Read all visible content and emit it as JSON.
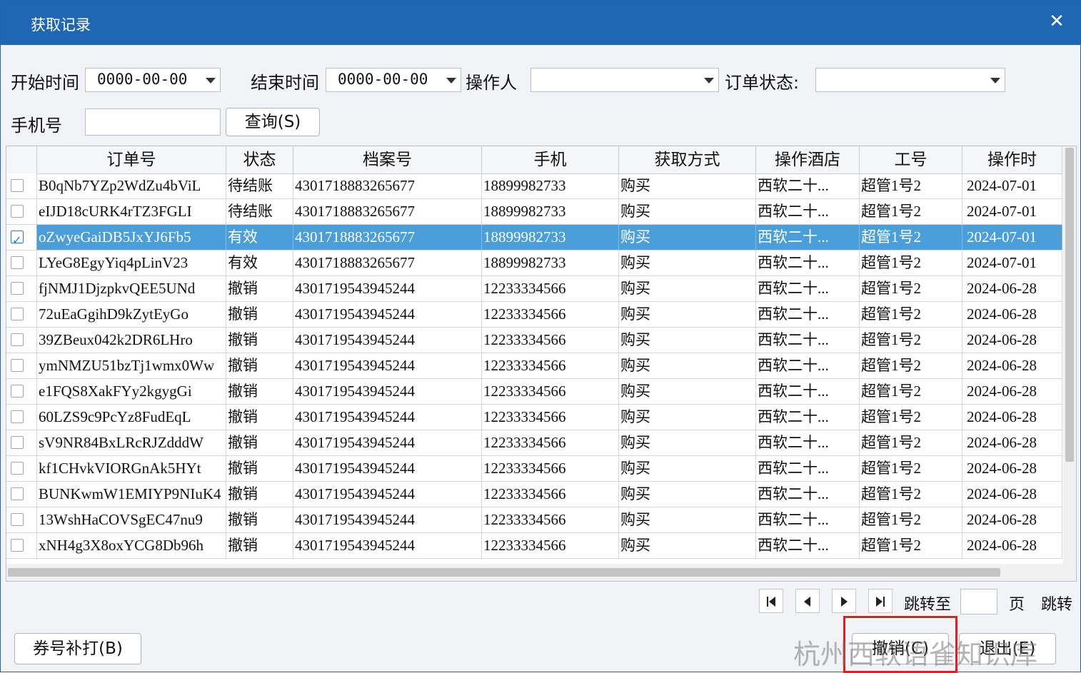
{
  "window": {
    "title": "获取记录",
    "close_symbol": "✕"
  },
  "filters": {
    "start_label": "开始时间",
    "start_value": "0000-00-00",
    "end_label": "结束时间",
    "end_value": "0000-00-00",
    "operator_label": "操作人",
    "operator_value": "",
    "status_label": "订单状态:",
    "status_value": "",
    "phone_label": "手机号",
    "phone_value": "",
    "query_label": "查询(S)"
  },
  "table": {
    "columns": [
      "订单号",
      "状态",
      "档案号",
      "手机",
      "获取方式",
      "操作酒店",
      "工号",
      "操作时"
    ],
    "rows": [
      {
        "checked": false,
        "order": "B0qNb7YZp2WdZu4bViL",
        "status": "待结账",
        "file": "4301718883265677",
        "phone": "18899982733",
        "method": "购买",
        "hotel": "西软二十...",
        "staff": "超管1号2",
        "time": "2024-07-01"
      },
      {
        "checked": false,
        "order": "eIJD18cURK4rTZ3FGLI",
        "status": "待结账",
        "file": "4301718883265677",
        "phone": "18899982733",
        "method": "购买",
        "hotel": "西软二十...",
        "staff": "超管1号2",
        "time": "2024-07-01"
      },
      {
        "checked": true,
        "order": "oZwyeGaiDB5JxYJ6Fb5",
        "status": "有效",
        "file": "4301718883265677",
        "phone": "18899982733",
        "method": "购买",
        "hotel": "西软二十...",
        "staff": "超管1号2",
        "time": "2024-07-01"
      },
      {
        "checked": false,
        "order": "LYeG8EgyYiq4pLinV23",
        "status": "有效",
        "file": "4301718883265677",
        "phone": "18899982733",
        "method": "购买",
        "hotel": "西软二十...",
        "staff": "超管1号2",
        "time": "2024-07-01"
      },
      {
        "checked": false,
        "order": "fjNMJ1DjzpkvQEE5UNd",
        "status": "撤销",
        "file": "4301719543945244",
        "phone": "12233334566",
        "method": "购买",
        "hotel": "西软二十...",
        "staff": "超管1号2",
        "time": "2024-06-28"
      },
      {
        "checked": false,
        "order": "72uEaGgihD9kZytEyGo",
        "status": "撤销",
        "file": "4301719543945244",
        "phone": "12233334566",
        "method": "购买",
        "hotel": "西软二十...",
        "staff": "超管1号2",
        "time": "2024-06-28"
      },
      {
        "checked": false,
        "order": "39ZBeux042k2DR6LHro",
        "status": "撤销",
        "file": "4301719543945244",
        "phone": "12233334566",
        "method": "购买",
        "hotel": "西软二十...",
        "staff": "超管1号2",
        "time": "2024-06-28"
      },
      {
        "checked": false,
        "order": "ymNMZU51bzTj1wmx0Ww",
        "status": "撤销",
        "file": "4301719543945244",
        "phone": "12233334566",
        "method": "购买",
        "hotel": "西软二十...",
        "staff": "超管1号2",
        "time": "2024-06-28"
      },
      {
        "checked": false,
        "order": "e1FQS8XakFYy2kgygGi",
        "status": "撤销",
        "file": "4301719543945244",
        "phone": "12233334566",
        "method": "购买",
        "hotel": "西软二十...",
        "staff": "超管1号2",
        "time": "2024-06-28"
      },
      {
        "checked": false,
        "order": "60LZS9c9PcYz8FudEqL",
        "status": "撤销",
        "file": "4301719543945244",
        "phone": "12233334566",
        "method": "购买",
        "hotel": "西软二十...",
        "staff": "超管1号2",
        "time": "2024-06-28"
      },
      {
        "checked": false,
        "order": "sV9NR84BxLRcRJZdddW",
        "status": "撤销",
        "file": "4301719543945244",
        "phone": "12233334566",
        "method": "购买",
        "hotel": "西软二十...",
        "staff": "超管1号2",
        "time": "2024-06-28"
      },
      {
        "checked": false,
        "order": "kf1CHvkVIORGnAk5HYt",
        "status": "撤销",
        "file": "4301719543945244",
        "phone": "12233334566",
        "method": "购买",
        "hotel": "西软二十...",
        "staff": "超管1号2",
        "time": "2024-06-28"
      },
      {
        "checked": false,
        "order": "BUNKwmW1EMIYP9NIuK4",
        "status": "撤销",
        "file": "4301719543945244",
        "phone": "12233334566",
        "method": "购买",
        "hotel": "西软二十...",
        "staff": "超管1号2",
        "time": "2024-06-28"
      },
      {
        "checked": false,
        "order": "13WshHaCOVSgEC47nu9",
        "status": "撤销",
        "file": "4301719543945244",
        "phone": "12233334566",
        "method": "购买",
        "hotel": "西软二十...",
        "staff": "超管1号2",
        "time": "2024-06-28"
      },
      {
        "checked": false,
        "order": "xNH4g3X8oxYCG8Db96h",
        "status": "撤销",
        "file": "4301719543945244",
        "phone": "12233334566",
        "method": "购买",
        "hotel": "西软二十...",
        "staff": "超管1号2",
        "time": "2024-06-28"
      }
    ]
  },
  "pager": {
    "jump_label": "跳转至",
    "page_value": "",
    "page_unit": "页",
    "jump_button": "跳转"
  },
  "footer": {
    "reprint_label": "券号补打(B)",
    "cancel_label": "撤销(C)",
    "exit_label": "退出(E)"
  },
  "watermark": "杭州西软语雀知识库",
  "colors": {
    "titlebar": "#1f66b4",
    "selected_row": "#4a9ed9",
    "highlight_box": "#e02020"
  }
}
